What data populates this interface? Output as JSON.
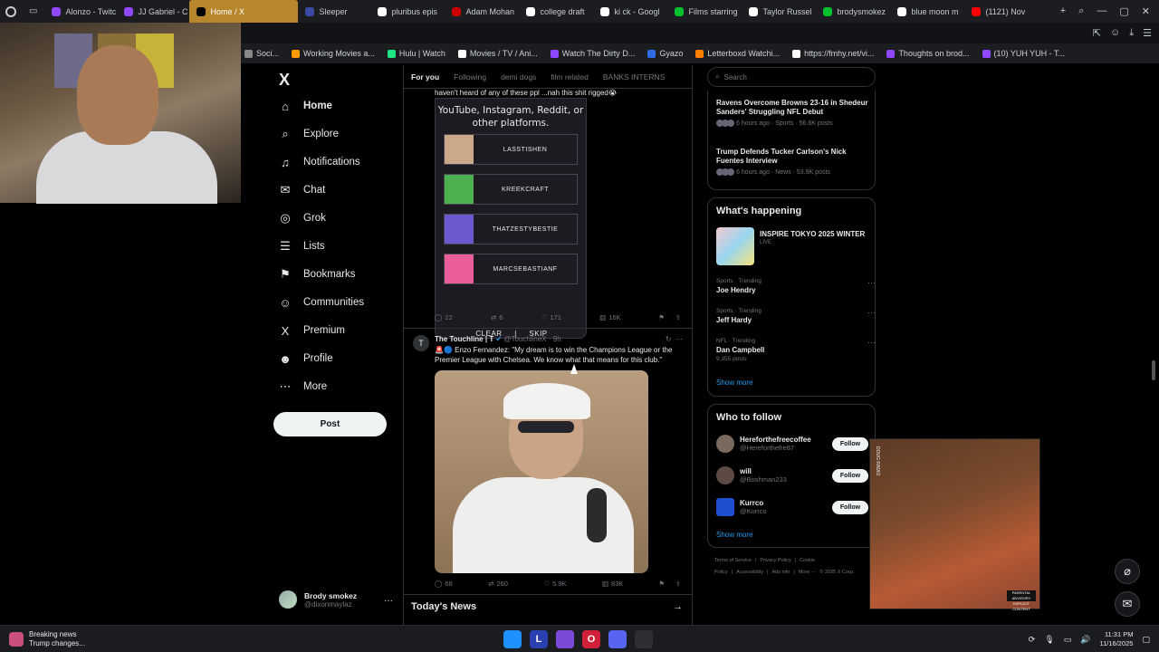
{
  "browser": {
    "tabs": [
      {
        "label": "Alonzo - Twitc",
        "color": "#9146ff"
      },
      {
        "label": "JJ Gabriel - C",
        "color": "#9146ff"
      },
      {
        "label": "Home / X",
        "color": "#000000",
        "active": true
      },
      {
        "label": "Sleeper",
        "color": "#3a4aa0"
      },
      {
        "label": "pluribus epis",
        "color": "#ffffff"
      },
      {
        "label": "Adam Mohan",
        "color": "#cc0000"
      },
      {
        "label": "college draft",
        "color": "#ffffff"
      },
      {
        "label": "ki ck - Googl",
        "color": "#ffffff"
      },
      {
        "label": "Films starring",
        "color": "#00c030"
      },
      {
        "label": "Taylor Russel",
        "color": "#ffffff"
      },
      {
        "label": "brodysmokez",
        "color": "#00c030"
      },
      {
        "label": "blue moon m",
        "color": "#ffffff"
      },
      {
        "label": "(1121) Nov",
        "color": "#ff0000"
      }
    ],
    "bookmarks": [
      {
        "label": "Soci...",
        "color": "#888888"
      },
      {
        "label": "Working Movies a...",
        "color": "#ff9900"
      },
      {
        "label": "Hulu | Watch",
        "color": "#1ce783"
      },
      {
        "label": "Movies / TV / Ani...",
        "color": "#ffffff"
      },
      {
        "label": "Watch The Dirty D...",
        "color": "#9146ff"
      },
      {
        "label": "Gyazo",
        "color": "#2e6be6"
      },
      {
        "label": "Letterboxd Watchi...",
        "color": "#ff8000"
      },
      {
        "label": "https://fmhy.net/vi...",
        "color": "#ffffff"
      },
      {
        "label": "Thoughts on brod...",
        "color": "#9146ff"
      },
      {
        "label": "(10) YUH YUH - T...",
        "color": "#9146ff"
      }
    ]
  },
  "sidebar": {
    "logo": "X",
    "items": [
      {
        "label": "Home",
        "icon": "house-icon",
        "glyph": "⌂"
      },
      {
        "label": "Explore",
        "icon": "search-icon",
        "glyph": "⌕"
      },
      {
        "label": "Notifications",
        "icon": "bell-icon",
        "glyph": "♫"
      },
      {
        "label": "Chat",
        "icon": "envelope-icon",
        "glyph": "✉"
      },
      {
        "label": "Grok",
        "icon": "grok-icon",
        "glyph": "◎"
      },
      {
        "label": "Lists",
        "icon": "list-icon",
        "glyph": "☰"
      },
      {
        "label": "Bookmarks",
        "icon": "bookmark-icon",
        "glyph": "⚑"
      },
      {
        "label": "Communities",
        "icon": "people-icon",
        "glyph": "☺"
      },
      {
        "label": "Premium",
        "icon": "x-premium-icon",
        "glyph": "X"
      },
      {
        "label": "Profile",
        "icon": "person-icon",
        "glyph": "☻"
      },
      {
        "label": "More",
        "icon": "more-circle-icon",
        "glyph": "⋯"
      }
    ],
    "post_label": "Post",
    "account": {
      "name": "Brody smokez",
      "handle": "@dixonmaylaz",
      "more": "···"
    }
  },
  "feed": {
    "tabs": [
      "For you",
      "Following",
      "demi dogs",
      "film related",
      "BANKS INTERNS"
    ],
    "tweet1": {
      "text": "haven't heard of any of these ppl ...nah this shit rigged😭",
      "card_lead": "YouTube, Instagram, Reddit, or other platforms.",
      "options": [
        "LASSTISHEN",
        "KREEKCRAFT",
        "THATZESTYBESTIE",
        "MARCSEBASTIANF"
      ],
      "clear": "CLEAR",
      "divider": "|",
      "skip": "SKIP",
      "stats": {
        "replies": "22",
        "reposts": "6",
        "likes": "171",
        "views": "16K"
      }
    },
    "tweet2": {
      "name": "The Touchline | T",
      "handle": "@TouchlineX",
      "time": "· 9h",
      "text": "🚨🔵 Enzo Fernandez: \"My dream is to win the Champions League or the Premier League with Chelsea. We know what that means for this club.\"",
      "stats": {
        "replies": "68",
        "reposts": "260",
        "likes": "5.9K",
        "views": "83K"
      }
    },
    "todays_news": "Today's News",
    "arrow": "→"
  },
  "right": {
    "search_placeholder": "Search",
    "news": [
      {
        "title": "Ravens Overcome Browns 23-16 in Shedeur Sanders' Struggling NFL Debut",
        "meta": "6 hours ago · Sports · 56.6K posts"
      },
      {
        "title": "Trump Defends Tucker Carlson's Nick Fuentes Interview",
        "meta": "6 hours ago · News · 53.9K posts"
      }
    ],
    "happening": {
      "title": "What's happening",
      "event": "INSPIRE TOKYO 2025 WINTER",
      "event_status": "LIVE",
      "trends": [
        {
          "category": "Sports · Trending",
          "name": "Joe Hendry",
          "posts": ""
        },
        {
          "category": "Sports · Trending",
          "name": "Jeff Hardy",
          "posts": ""
        },
        {
          "category": "NFL · Trending",
          "name": "Dan Campbell",
          "posts": "9,355 posts"
        }
      ],
      "show_more": "Show more"
    },
    "who_to_follow": {
      "title": "Who to follow",
      "users": [
        {
          "name": "Hereforthefreecoffee",
          "handle": "@Hereforthefre87",
          "color": "#7a6a5e"
        },
        {
          "name": "will",
          "handle": "@Boshman233",
          "color": "#5e4a44"
        },
        {
          "name": "Kurrco",
          "handle": "@Kurrco",
          "color": "#1f4fd0"
        }
      ],
      "follow_label": "Follow",
      "show_more": "Show more"
    },
    "footer": [
      "Terms of Service",
      "|",
      "Privacy Policy",
      "|",
      "Cookie Policy",
      "|",
      "Accessibility",
      "|",
      "Ads info",
      "|",
      "More ···",
      "© 2025 X Corp."
    ]
  },
  "album": {
    "side_text": "DOUG RADIO",
    "advisory": "PARENTAL ADVISORY EXPLICIT CONTENT"
  },
  "taskbar": {
    "news_title": "Breaking news",
    "news_sub": "Trump changes...",
    "apps": [
      {
        "label": "",
        "color": "#1e90ff"
      },
      {
        "label": "L",
        "color": "#2a3fb0"
      },
      {
        "label": "",
        "color": "#7b4bd8"
      },
      {
        "label": "O",
        "color": "#d1203a"
      },
      {
        "label": "",
        "color": "#5865f2"
      },
      {
        "label": "",
        "color": "#2d2f33"
      }
    ],
    "time": "11:31 PM",
    "date": "11/16/2025"
  }
}
